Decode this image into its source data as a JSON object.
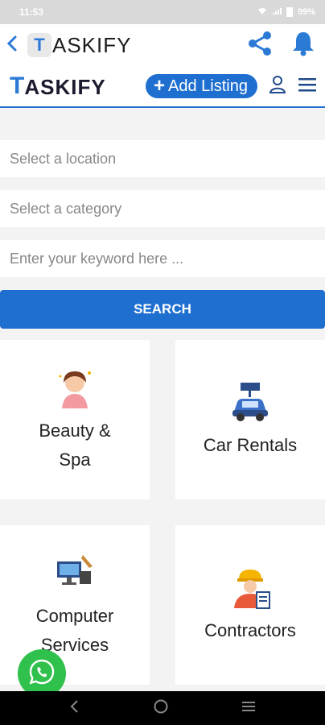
{
  "status_bar": {
    "time": "11:53",
    "battery": "99%"
  },
  "app_bar": {
    "logo_letter": "T",
    "title": "ASKIFY",
    "icons": [
      "back-icon",
      "share-icon",
      "bell-icon"
    ]
  },
  "site_header": {
    "brand_first": "T",
    "brand_rest": "ASKIFY",
    "add_listing_label": "Add Listing",
    "icons": [
      "user-icon",
      "hamburger-menu-icon"
    ]
  },
  "search": {
    "location_placeholder": "Select a location",
    "category_placeholder": "Select a category",
    "keyword_placeholder": "Enter your keyword here ...",
    "button_label": "SEARCH"
  },
  "categories": [
    {
      "label": "Beauty & Spa",
      "icon": "beauty-spa-icon"
    },
    {
      "label": "Car Rentals",
      "icon": "car-rental-icon"
    },
    {
      "label": "Computer Services",
      "icon": "computer-services-icon"
    },
    {
      "label": "Contractors",
      "icon": "contractor-icon"
    }
  ],
  "colors": {
    "primary": "#1f6fd1",
    "whatsapp": "#2fc14c"
  }
}
